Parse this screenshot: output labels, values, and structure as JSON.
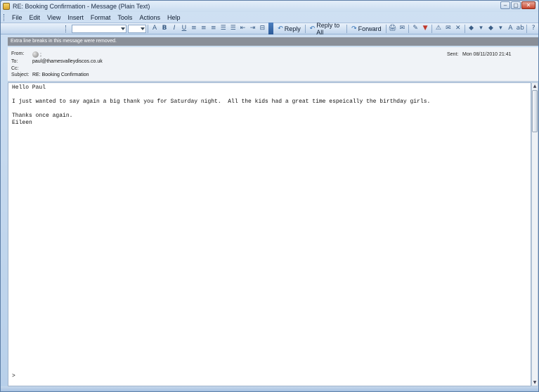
{
  "window": {
    "title": "RE: Booking Confirmation - Message (Plain Text)",
    "buttons": {
      "minimize": "–",
      "maximize": "▢",
      "close": "✕"
    }
  },
  "menu": {
    "items": [
      {
        "label": "File",
        "key": "F"
      },
      {
        "label": "Edit",
        "key": "E"
      },
      {
        "label": "View",
        "key": "V"
      },
      {
        "label": "Insert",
        "key": "I"
      },
      {
        "label": "Format",
        "key": "o"
      },
      {
        "label": "Tools",
        "key": "T"
      },
      {
        "label": "Actions",
        "key": "A"
      },
      {
        "label": "Help",
        "key": "H"
      }
    ]
  },
  "toolbar": {
    "format_icons": [
      "A",
      "B",
      "I",
      "U",
      "≡",
      "≡",
      "≡",
      "☰",
      "☰",
      "⇤",
      "⇥",
      "⊟"
    ],
    "reply_label": "Reply",
    "reply_all_label": "Reply to All",
    "forward_label": "Forward",
    "action_icons": [
      "🖨",
      "✉",
      "✎",
      "▼",
      "⚠",
      "✉",
      "✕",
      "◆",
      "▾",
      "◆",
      "▾",
      "A",
      "ab",
      "?"
    ]
  },
  "infobar": {
    "text": "Extra line breaks in this message were removed."
  },
  "header": {
    "from_label": "From:",
    "from_value": ";",
    "to_label": "To:",
    "to_value": "paul@thamesvalleydiscos.co.uk",
    "cc_label": "Cc:",
    "cc_value": "",
    "subject_label": "Subject:",
    "subject_value": "RE: Booking Confirmation",
    "sent_label": "Sent:",
    "sent_value": "Mon 08/11/2010 21:41"
  },
  "body": {
    "text": "Hello Paul\n\nI just wanted to say again a big thank you for Saturday night.  All the kids had a great time espeically the birthday girls.\n\nThanks once again.\nEileen\n\n\n\n\n\n\n\n\n\n\n\n\n\n\n\n\n\n\n\n\n\n\n\n\n\n\n\n\n\n\n\n\n\n\n\n>"
  },
  "scrollbar": {
    "up": "▲",
    "down": "▼"
  }
}
